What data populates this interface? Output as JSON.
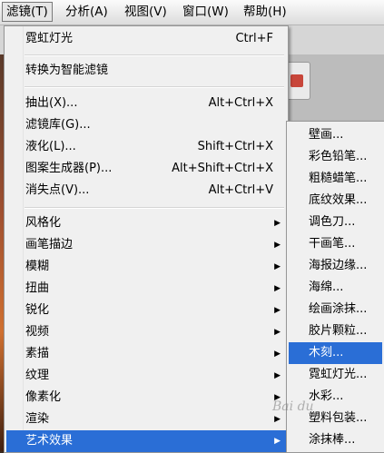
{
  "menubar": {
    "items": [
      {
        "label": "滤镜(T)",
        "active": true
      },
      {
        "label": "分析(A)",
        "active": false
      },
      {
        "label": "视图(V)",
        "active": false
      },
      {
        "label": "窗口(W)",
        "active": false
      },
      {
        "label": "帮助(H)",
        "active": false
      }
    ]
  },
  "filter_menu": {
    "items": [
      {
        "label": "霓虹灯光",
        "shortcut": "Ctrl+F"
      },
      {
        "label": "转换为智能滤镜",
        "shortcut": ""
      },
      {
        "label": "抽出(X)...",
        "shortcut": "Alt+Ctrl+X"
      },
      {
        "label": "滤镜库(G)...",
        "shortcut": ""
      },
      {
        "label": "液化(L)...",
        "shortcut": "Shift+Ctrl+X"
      },
      {
        "label": "图案生成器(P)...",
        "shortcut": "Alt+Shift+Ctrl+X"
      },
      {
        "label": "消失点(V)...",
        "shortcut": "Alt+Ctrl+V"
      },
      {
        "label": "风格化",
        "submenu": true
      },
      {
        "label": "画笔描边",
        "submenu": true
      },
      {
        "label": "模糊",
        "submenu": true
      },
      {
        "label": "扭曲",
        "submenu": true
      },
      {
        "label": "锐化",
        "submenu": true
      },
      {
        "label": "视频",
        "submenu": true
      },
      {
        "label": "素描",
        "submenu": true
      },
      {
        "label": "纹理",
        "submenu": true
      },
      {
        "label": "像素化",
        "submenu": true
      },
      {
        "label": "渲染",
        "submenu": true
      },
      {
        "label": "艺术效果",
        "submenu": true,
        "highlighted": true
      }
    ]
  },
  "artistic_submenu": {
    "items": [
      {
        "label": "壁画..."
      },
      {
        "label": "彩色铅笔..."
      },
      {
        "label": "粗糙蜡笔..."
      },
      {
        "label": "底纹效果..."
      },
      {
        "label": "调色刀..."
      },
      {
        "label": "干画笔..."
      },
      {
        "label": "海报边缘..."
      },
      {
        "label": "海绵..."
      },
      {
        "label": "绘画涂抹..."
      },
      {
        "label": "胶片颗粒..."
      },
      {
        "label": "木刻...",
        "highlighted": true
      },
      {
        "label": "霓虹灯光..."
      },
      {
        "label": "水彩..."
      },
      {
        "label": "塑料包装..."
      },
      {
        "label": "涂抹棒..."
      }
    ]
  },
  "colors": {
    "highlight": "#2a6ed6",
    "menu_bg": "#f0f0f0"
  }
}
